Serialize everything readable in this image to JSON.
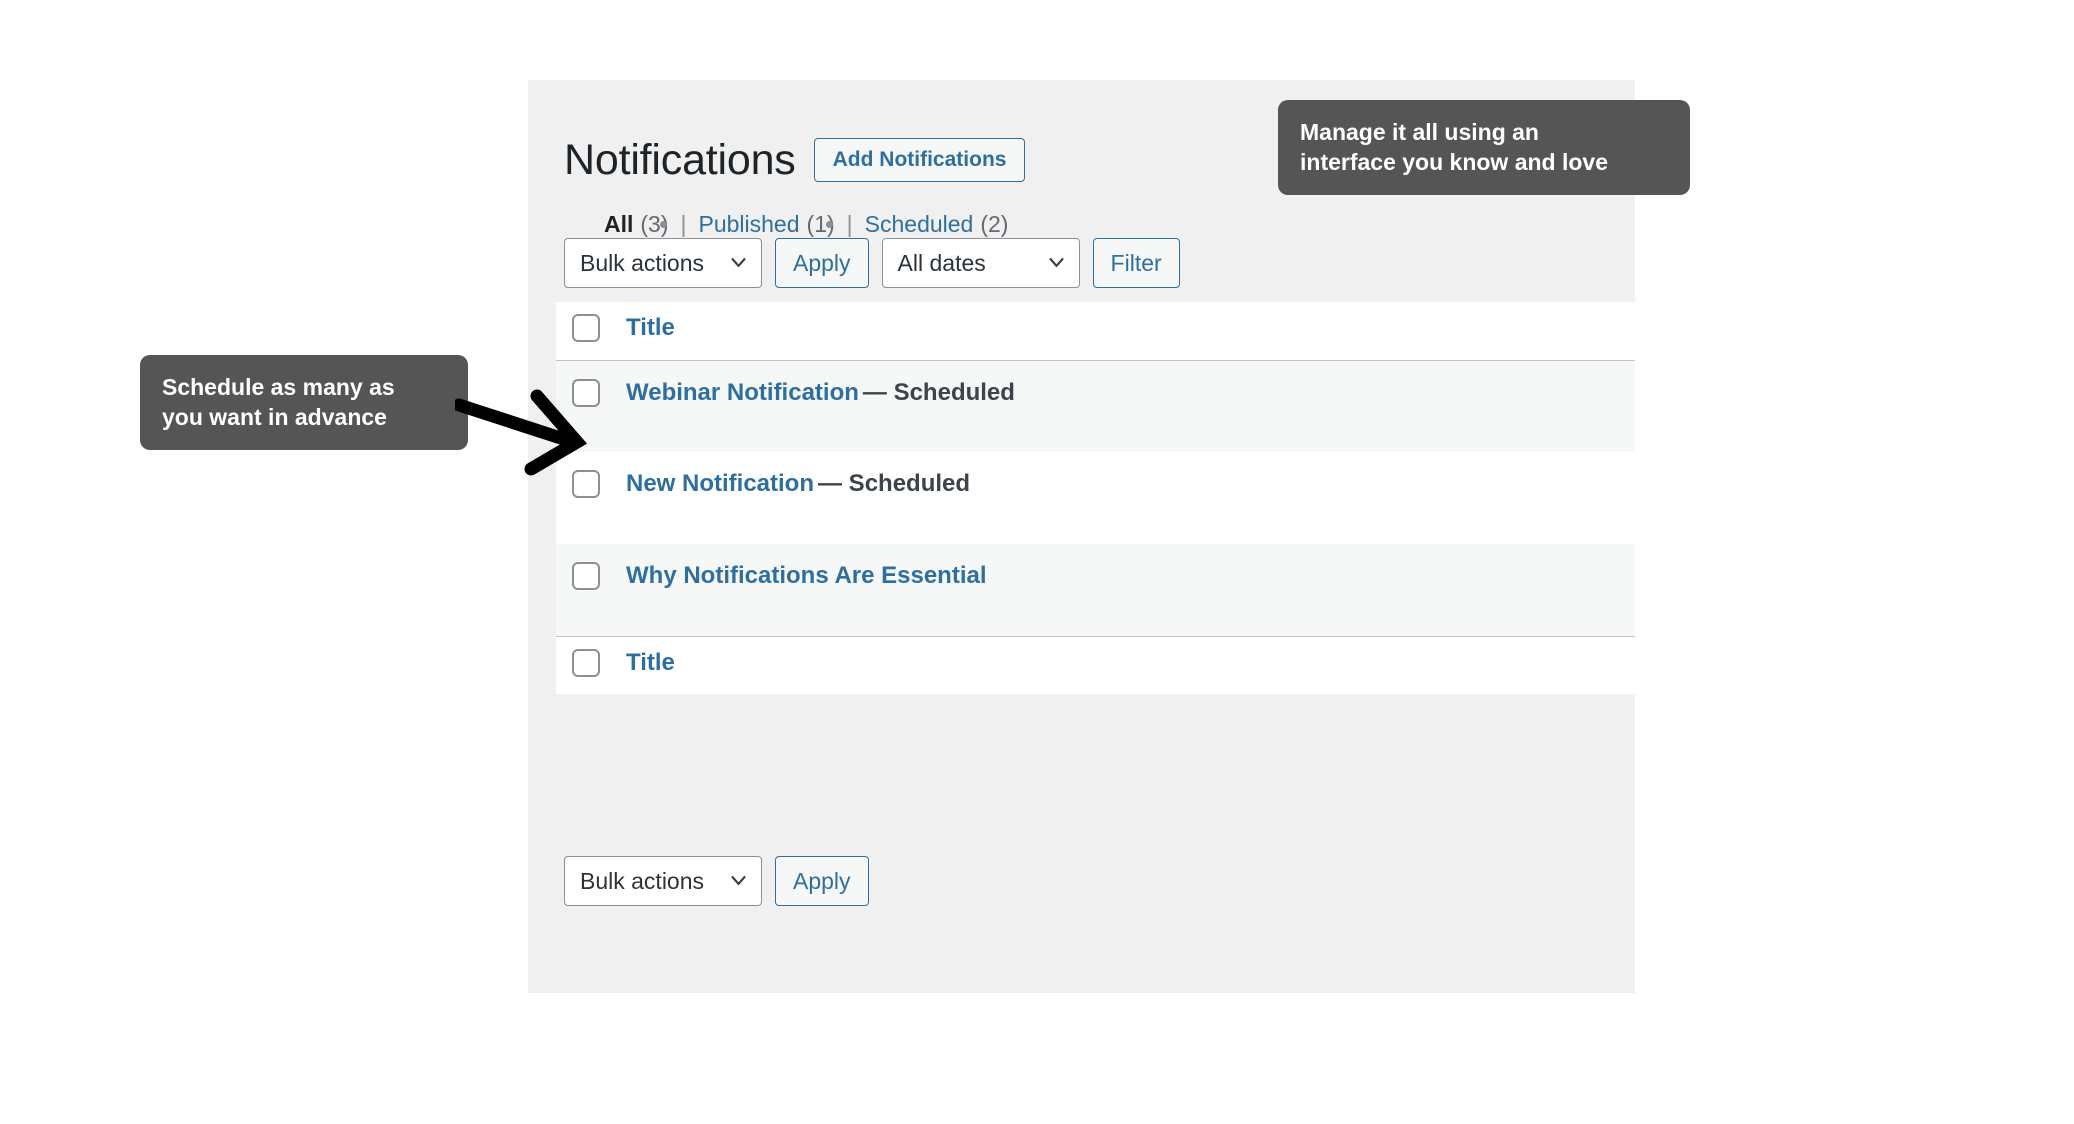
{
  "page": {
    "title": "Notifications",
    "add_button": "Add Notifications"
  },
  "filters": [
    {
      "label": "All",
      "count": "(3)",
      "current": true
    },
    {
      "label": "Published",
      "count": "(1)",
      "current": false
    },
    {
      "label": "Scheduled",
      "count": "(2)",
      "current": false
    }
  ],
  "separator": "|",
  "tablenav_top": {
    "bulk_select_value": "Bulk actions",
    "apply_label": "Apply",
    "date_select_value": "All dates",
    "filter_label": "Filter"
  },
  "tablenav_bottom": {
    "bulk_select_value": "Bulk actions",
    "apply_label": "Apply"
  },
  "table": {
    "column_header": "Title",
    "column_footer": "Title",
    "rows": [
      {
        "title": "Webinar Notification",
        "state": "— Scheduled"
      },
      {
        "title": "New Notification",
        "state": "— Scheduled"
      },
      {
        "title": "Why Notifications Are Essential",
        "state": ""
      }
    ]
  },
  "annotations": {
    "right": "Manage it all using an\ninterface you know and love",
    "left": "Schedule as many as\nyou want in advance"
  },
  "colors": {
    "panel_bg": "#f0f0f1",
    "link_blue": "#2f6f9f",
    "text_dark": "#1d2327",
    "muted": "#646970",
    "row_alt": "#f6f7f7",
    "callout_bg": "#555555",
    "border": "#c3c4c7"
  }
}
